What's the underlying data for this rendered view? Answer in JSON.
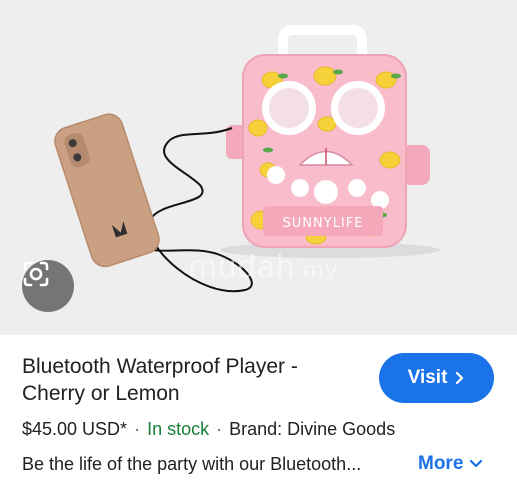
{
  "photo": {
    "watermark": "mudah",
    "watermark_suffix": ".my",
    "speaker_brand": "SUNNYLIFE"
  },
  "lens": {
    "icon": "camera-lens-icon"
  },
  "product": {
    "title": "Bluetooth Waterproof Player - Cherry or Lemon",
    "price": "$45.00 USD*",
    "stock": "In stock",
    "brand": "Brand: Divine Goods",
    "separator": "·",
    "description": "Be the life of the party with our Bluetooth..."
  },
  "actions": {
    "visit_label": "Visit",
    "more_label": "More"
  },
  "colors": {
    "accent": "#1a73e8",
    "stock": "#188038",
    "speaker_pink": "#f6b8c6",
    "lemon": "#f5d23a"
  }
}
